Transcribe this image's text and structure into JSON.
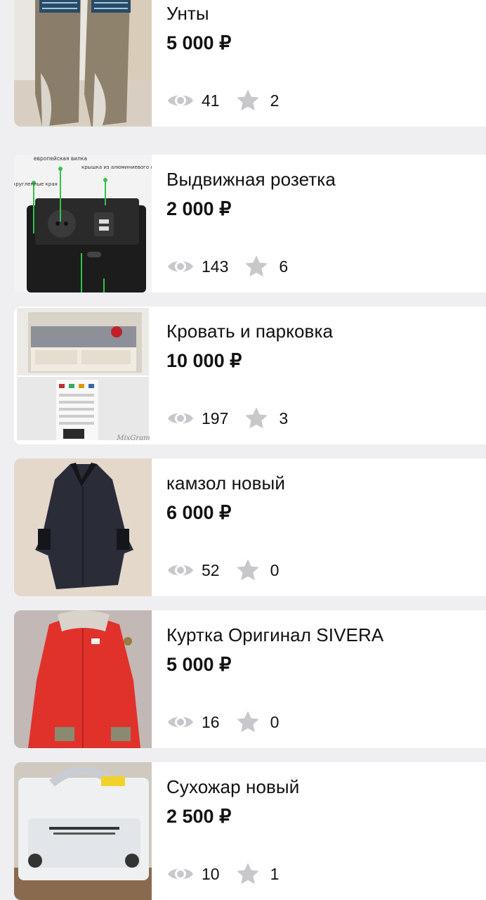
{
  "listings": [
    {
      "title": "Унты",
      "price": "5 000 ₽",
      "views": "41",
      "favorites": "2"
    },
    {
      "title": "Выдвижная розетка",
      "price": "2 000 ₽",
      "views": "143",
      "favorites": "6",
      "image_labels": {
        "a": "европейская вилка",
        "b": "закругленные края",
        "c": "крышка из алюминиевого сплава"
      }
    },
    {
      "title": "Кровать и парковка",
      "price": "10 000 ₽",
      "views": "197",
      "favorites": "3",
      "watermark": "MixGram"
    },
    {
      "title": "камзол новый",
      "price": "6 000 ₽",
      "views": "52",
      "favorites": "0"
    },
    {
      "title": "Куртка Оригинал SIVERA",
      "price": "5 000 ₽",
      "views": "16",
      "favorites": "0"
    },
    {
      "title": "Сухожар новый",
      "price": "2 500 ₽",
      "views": "10",
      "favorites": "1"
    }
  ],
  "icons": {
    "views": "eye-icon",
    "favorites": "star-icon"
  },
  "colors": {
    "background": "#efeff1",
    "card": "#ffffff",
    "icon": "#c7c7cc",
    "text": "#111111"
  }
}
